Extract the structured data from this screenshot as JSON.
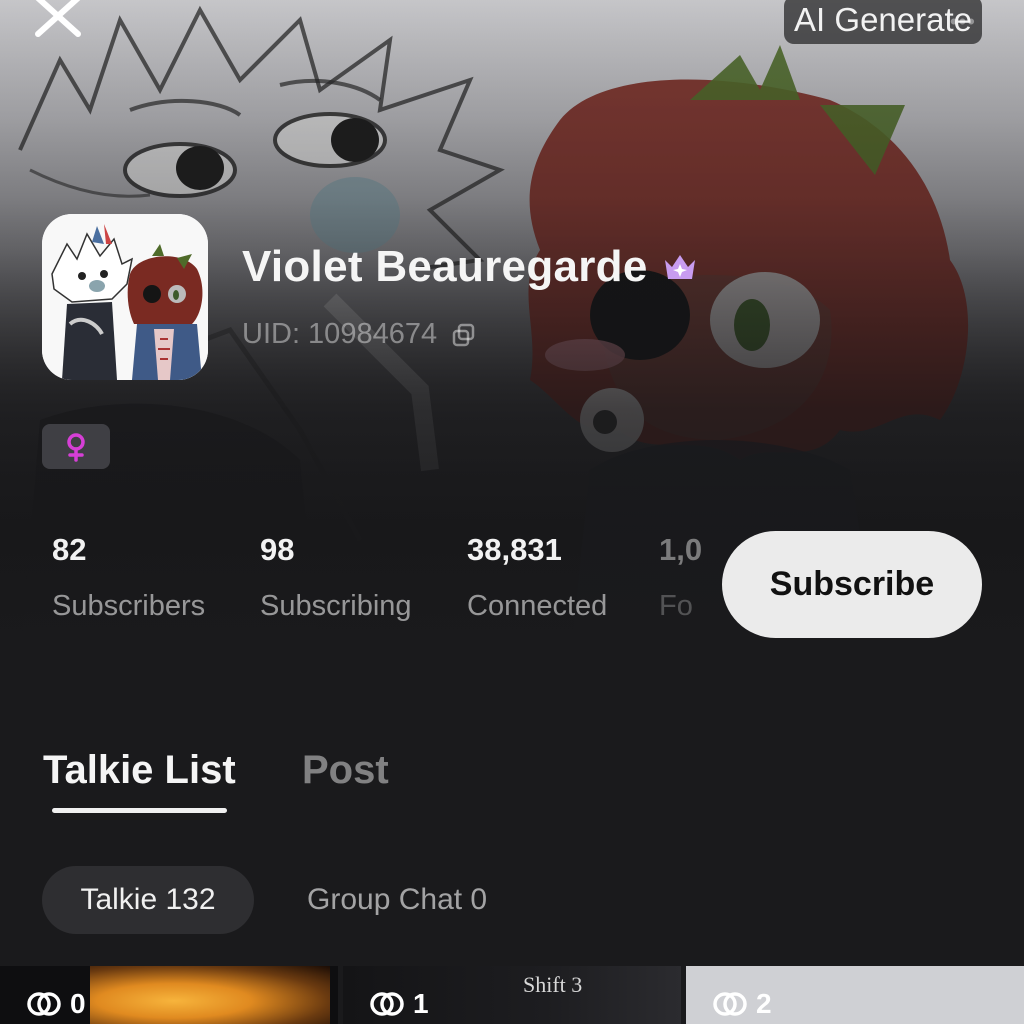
{
  "top_bar": {
    "ai_generate_label": "AI Generate",
    "more_label": "•••"
  },
  "profile": {
    "name": "Violet Beauregarde",
    "uid_text": "UID: 10984674",
    "gender_symbol": "♀"
  },
  "stats": [
    {
      "value": "82",
      "label": "Subscribers"
    },
    {
      "value": "98",
      "label": "Subscribing"
    },
    {
      "value": "38,831",
      "label": "Connected"
    },
    {
      "value": "1,0",
      "label": "Fo"
    }
  ],
  "subscribe_label": "Subscribe",
  "tabs": [
    {
      "label": "Talkie List"
    },
    {
      "label": "Post"
    }
  ],
  "chips": [
    {
      "label": "Talkie 132"
    },
    {
      "label": "Group Chat 0"
    }
  ],
  "cards": [
    {
      "count": "0"
    },
    {
      "count": "1",
      "title": "Shift 3"
    },
    {
      "count": "2"
    }
  ],
  "icons": {
    "close": "close-icon",
    "crown": "crown-icon",
    "copy": "copy-icon",
    "female": "female-icon",
    "link": "link-icon"
  },
  "colors": {
    "accent_purple": "#c89cf0",
    "female_pink": "#d63fd6",
    "subscribe_bg": "#ebebeb"
  }
}
